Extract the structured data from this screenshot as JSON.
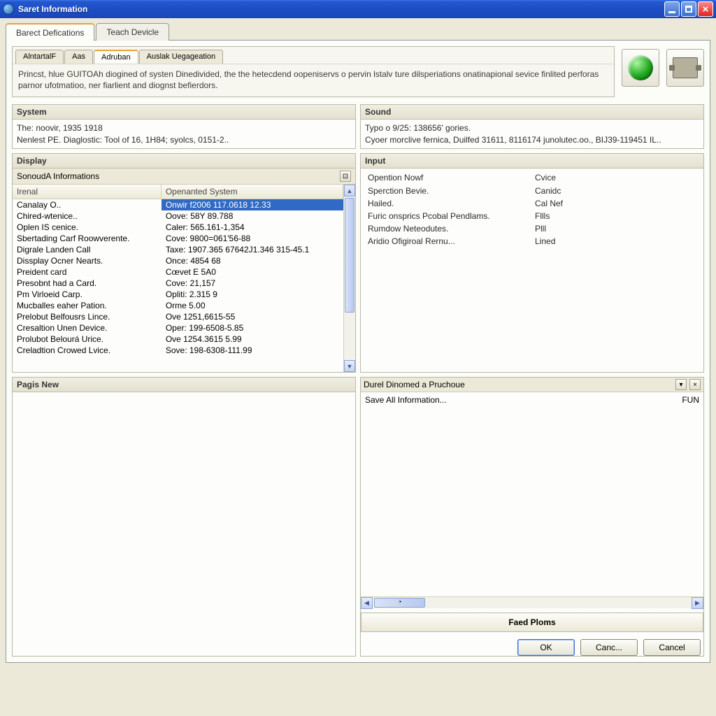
{
  "window": {
    "title": "Saret Information"
  },
  "maintabs": {
    "t0": "Barect Defications",
    "t1": "Teach Devicle"
  },
  "subtabs": {
    "t0": "AlntartalF",
    "t1": "Aas",
    "t2": "Adruban",
    "t3": "Auslak Uegageation"
  },
  "description": "Princst, hlue GUITOAh diogined of systen Dinedivided, the the hetecdend oopeniservs o pervin lstalv ture dilsperiations onatinapional sevice finlited perforas parnor ufotmatioo, ner fiarlient and diognst befierdors.",
  "icons": {
    "globe": "globe-icon",
    "device": "device-icon"
  },
  "system": {
    "title": "System",
    "line1": "The: noovir, 1935 1918",
    "line2": "Nenlest PE. Diaglostic: Tool of 16, 1H84; syolcs, 0151-2.."
  },
  "sound": {
    "title": "Sound",
    "line1": "Typo o 9/25: 138656' gories.",
    "line2": "Cyoer morclive fernica, Duilfed 31611, 8116174 junolutec.oo., BIJ39-119451 IL.."
  },
  "display": {
    "title": "Display",
    "sub": "SonoudA Informations",
    "col1": "Irenal",
    "col2": "Openanted System",
    "rows": [
      {
        "c1": "Canalay O..",
        "c2": "Onwir f2006 117.0618 12.33"
      },
      {
        "c1": "Chired-wtenice..",
        "c2": "Oove: 58Y 89.788"
      },
      {
        "c1": "Oplen IS cenice.",
        "c2": "Caler: 565.161-1,354"
      },
      {
        "c1": "Sbertading Carf Roowverente.",
        "c2": "Cove: 9800=061'56-88"
      },
      {
        "c1": "Digrale Landen Call",
        "c2": "Taxe: 1907.365 67642J1.346 315-45.1"
      },
      {
        "c1": "Dissplay Ocner Nearts.",
        "c2": "Once: 4854 68"
      },
      {
        "c1": "Preident card",
        "c2": "Cœvet E 5A0"
      },
      {
        "c1": "Presobnt had a Card.",
        "c2": "Cove: 21,157"
      },
      {
        "c1": "Pm Virloeid Carp.",
        "c2": "Opliti: 2.315 9"
      },
      {
        "c1": "Mucballes eaher Pation.",
        "c2": "Orme 5.00"
      },
      {
        "c1": "Prelobut Belfousrs Lince.",
        "c2": "Ove 1251,6615-55"
      },
      {
        "c1": "Cresaltion Unen Device.",
        "c2": "Oper: 199-6508-5.85"
      },
      {
        "c1": "Prolubot Belourá Urice.",
        "c2": "Ove 1254.3615 5.99"
      },
      {
        "c1": "Creladtion Crowed Lvice.",
        "c2": "Sove: 198-6308-111.99"
      }
    ]
  },
  "input": {
    "title": "Input",
    "rows": [
      {
        "k": "Opention Nowf",
        "v": "Cvice"
      },
      {
        "k": "Sperction Bevie.",
        "v": "Canidc"
      },
      {
        "k": "Hailed.",
        "v": "Cal Nef"
      },
      {
        "k": "Furic onsprics Pcobal Pendlams.",
        "v": "Fllls"
      },
      {
        "k": "Rumdow Neteodutes.",
        "v": "Plll"
      },
      {
        "k": "Aridio Ofigiroal Rernu...",
        "v": "Lined"
      }
    ]
  },
  "pagis": {
    "title": "Pagis New"
  },
  "durel": {
    "title": "Durel Dinomed a Pruchoue",
    "save_label": "Save All Information...",
    "save_val": "FUN"
  },
  "faed": "Faed Ploms",
  "buttons": {
    "ok": "OK",
    "canc": "Canc...",
    "cancel": "Cancel"
  }
}
